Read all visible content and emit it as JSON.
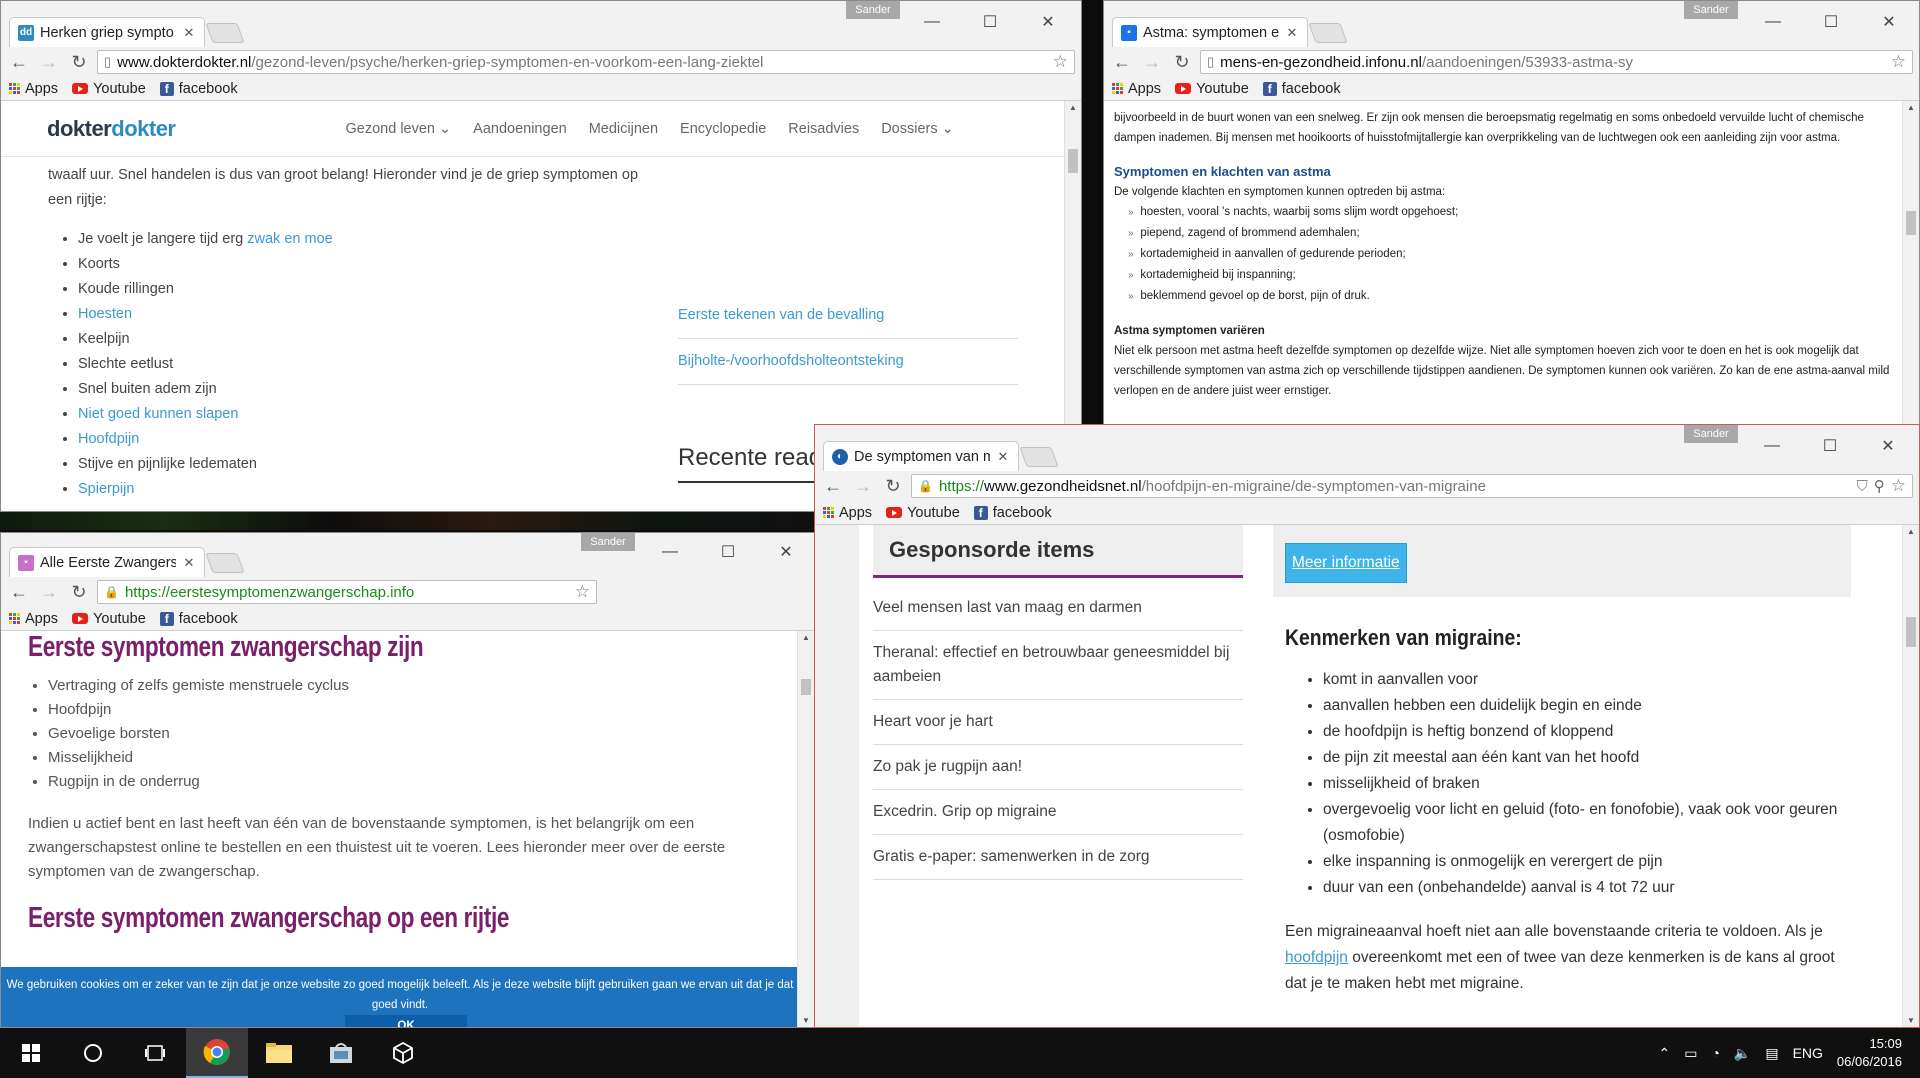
{
  "bookmarks": {
    "apps": "Apps",
    "youtube": "Youtube",
    "facebook": "facebook"
  },
  "w1": {
    "tab_title": "Herken griep sympto",
    "user": "Sander",
    "url_domain": "www.dokterdokter.nl",
    "url_path": "/gezond-leven/psyche/herken-griep-symptomen-en-voorkom-een-lang-ziektel",
    "logo_a": "dokter",
    "logo_b": "dokter",
    "nav": [
      "Gezond leven ⌄",
      "Aandoeningen",
      "Medicijnen",
      "Encyclopedie",
      "Reisadvies",
      "Dossiers ⌄"
    ],
    "intro": "twaalf uur. Snel handelen is dus van groot belang! Hieronder vind je de griep symptomen op een rijtje:",
    "list": [
      {
        "pre": "Je voelt je langere tijd erg ",
        "link": "zwak en moe"
      },
      {
        "pre": "Koorts",
        "link": ""
      },
      {
        "pre": "Koude rillingen",
        "link": ""
      },
      {
        "pre": "",
        "link": "Hoesten"
      },
      {
        "pre": "Keelpijn",
        "link": ""
      },
      {
        "pre": "Slechte eetlust",
        "link": ""
      },
      {
        "pre": "Snel buiten adem zijn",
        "link": ""
      },
      {
        "pre": "",
        "link": "Niet goed kunnen slapen"
      },
      {
        "pre": "",
        "link": "Hoofdpijn"
      },
      {
        "pre": "Stijve en pijnlijke ledematen",
        "link": ""
      },
      {
        "pre": "",
        "link": "Spierpijn"
      }
    ],
    "sidebar_links": [
      "Eerste tekenen van de bevalling",
      "Bijholte-/voorhoofdsholteontsteking"
    ],
    "recent": "Recente read"
  },
  "w2": {
    "tab_title": "Astma: symptomen e",
    "user": "Sander",
    "url_domain": "mens-en-gezondheid.infonu.nl",
    "url_path": "/aandoeningen/53933-astma-sy",
    "p1": "bijvoorbeeld in de buurt wonen van een snelweg. Er zijn ook mensen die beroepsmatig regelmatig en soms onbedoeld vervuilde lucht of chemische dampen inademen. Bij mensen met hooikoorts of huisstofmijtallergie kan overprikkeling van de luchtwegen ook een aanleiding zijn voor astma.",
    "h1": "Symptomen en klachten van astma",
    "p2": "De volgende klachten en symptomen kunnen optreden bij astma:",
    "list": [
      "hoesten, vooral 's nachts, waarbij soms slijm wordt opgehoest;",
      "piepend, zagend of brommend ademhalen;",
      "kortademigheid in aanvallen of gedurende perioden;",
      "kortademigheid bij inspanning;",
      "beklemmend gevoel op de borst, pijn of druk."
    ],
    "h2": "Astma symptomen variëren",
    "p3": "Niet elk persoon met astma heeft dezelfde symptomen op dezelfde wijze. Niet alle symptomen hoeven zich voor te doen en het is ook mogelijk dat verschillende symptomen van astma zich op verschillende tijdstippen aandienen. De symptomen kunnen ook variëren. Zo kan de ene astma-aanval mild verlopen en de andere juist weer ernstiger."
  },
  "w3": {
    "tab_title": "Alle Eerste Zwangers",
    "user": "Sander",
    "url": "https://eerstesymptomenzwangerschap.info",
    "h1": "Eerste symptomen zwangerschap zijn",
    "list": [
      "Vertraging of zelfs gemiste menstruele cyclus",
      "Hoofdpijn",
      "Gevoelige borsten",
      "Misselijkheid",
      "Rugpijn in de onderrug"
    ],
    "p1": "Indien u  actief bent en last heeft van één van de bovenstaande symptomen, is het belangrijk om een zwangerschapstest online te bestellen en een thuistest uit te voeren. Lees hieronder meer over de eerste symptomen van de zwangerschap.",
    "h2": "Eerste symptomen zwangerschap op een rijtje",
    "cookie_text": "We gebruiken cookies om er zeker van te zijn dat je onze website zo goed mogelijk beleeft. Als je deze website blijft gebruiken gaan we ervan uit dat je dat goed vindt.",
    "cookie_ok": "OK"
  },
  "w4": {
    "tab_title": "De symptomen van m",
    "user": "Sander",
    "url_https": "https://",
    "url_domain": "www.gezondheidsnet.nl",
    "url_path": "/hoofdpijn-en-migraine/de-symptomen-van-migraine",
    "sponsored": "Gesponsorde items",
    "sponsored_items": [
      "Veel mensen last van maag en darmen",
      "Theranal: effectief en betrouwbaar geneesmiddel bij aambeien",
      "Heart voor je hart",
      "Zo pak je rugpijn aan!",
      "Excedrin. Grip op migraine",
      "Gratis e-paper: samenwerken in de zorg"
    ],
    "info_button": "Meer informatie",
    "heading": "Kenmerken van migraine:",
    "list": [
      "komt in aanvallen voor",
      "aanvallen hebben een duidelijk begin en einde",
      "de hoofdpijn is heftig bonzend of kloppend",
      "de pijn zit meestal aan één kant van het hoofd",
      "misselijkheid of braken",
      "overgevoelig voor licht en geluid (foto- en fonofobie), vaak ook voor geuren (osmofobie)",
      "elke inspanning is onmogelijk en verergert de pijn",
      "duur van een (onbehandelde) aanval is 4 tot 72 uur"
    ],
    "p_pre": "Een migraineaanval hoeft niet aan alle bovenstaande criteria te voldoen. Als je ",
    "p_link": "hoofdpijn",
    "p_post": " overeenkomt met een of twee van deze kenmerken is de kans al groot dat je te maken hebt met migraine."
  },
  "taskbar": {
    "lang": "ENG",
    "time": "15:09",
    "date": "06/06/2016"
  }
}
